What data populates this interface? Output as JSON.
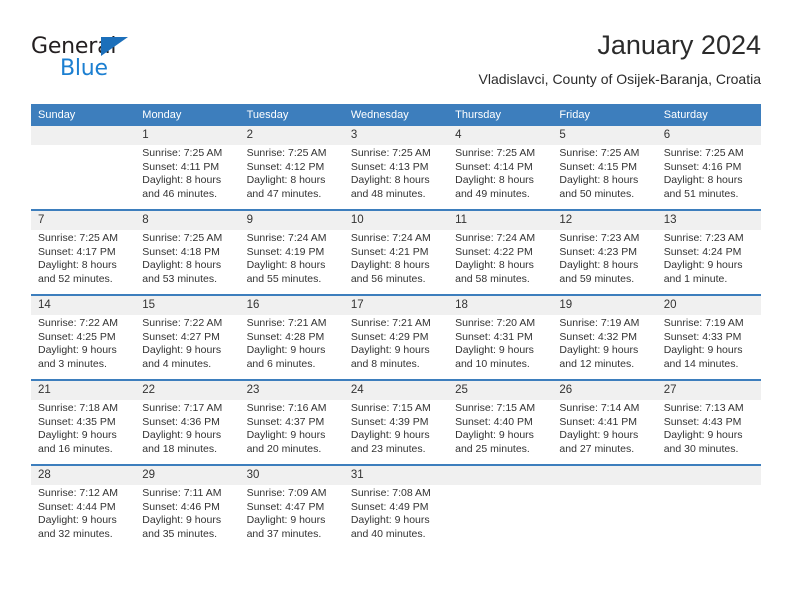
{
  "brand": {
    "name_top": "General",
    "name_bottom": "Blue",
    "triangle_color": "#1c6fba",
    "blue_color": "#1c7fd1"
  },
  "header": {
    "title": "January 2024",
    "subtitle": "Vladislavci, County of Osijek-Baranja, Croatia"
  },
  "theme": {
    "header_blue": "#3d7ebd",
    "daynum_band": "#f0f0f0",
    "cell_bg": "#ffffff",
    "text": "#333333"
  },
  "calendar": {
    "weekday_headers": [
      "Sunday",
      "Monday",
      "Tuesday",
      "Wednesday",
      "Thursday",
      "Friday",
      "Saturday"
    ],
    "weeks": [
      [
        {
          "day": "",
          "lines": []
        },
        {
          "day": "1",
          "lines": [
            "Sunrise: 7:25 AM",
            "Sunset: 4:11 PM",
            "Daylight: 8 hours",
            "and 46 minutes."
          ]
        },
        {
          "day": "2",
          "lines": [
            "Sunrise: 7:25 AM",
            "Sunset: 4:12 PM",
            "Daylight: 8 hours",
            "and 47 minutes."
          ]
        },
        {
          "day": "3",
          "lines": [
            "Sunrise: 7:25 AM",
            "Sunset: 4:13 PM",
            "Daylight: 8 hours",
            "and 48 minutes."
          ]
        },
        {
          "day": "4",
          "lines": [
            "Sunrise: 7:25 AM",
            "Sunset: 4:14 PM",
            "Daylight: 8 hours",
            "and 49 minutes."
          ]
        },
        {
          "day": "5",
          "lines": [
            "Sunrise: 7:25 AM",
            "Sunset: 4:15 PM",
            "Daylight: 8 hours",
            "and 50 minutes."
          ]
        },
        {
          "day": "6",
          "lines": [
            "Sunrise: 7:25 AM",
            "Sunset: 4:16 PM",
            "Daylight: 8 hours",
            "and 51 minutes."
          ]
        }
      ],
      [
        {
          "day": "7",
          "lines": [
            "Sunrise: 7:25 AM",
            "Sunset: 4:17 PM",
            "Daylight: 8 hours",
            "and 52 minutes."
          ]
        },
        {
          "day": "8",
          "lines": [
            "Sunrise: 7:25 AM",
            "Sunset: 4:18 PM",
            "Daylight: 8 hours",
            "and 53 minutes."
          ]
        },
        {
          "day": "9",
          "lines": [
            "Sunrise: 7:24 AM",
            "Sunset: 4:19 PM",
            "Daylight: 8 hours",
            "and 55 minutes."
          ]
        },
        {
          "day": "10",
          "lines": [
            "Sunrise: 7:24 AM",
            "Sunset: 4:21 PM",
            "Daylight: 8 hours",
            "and 56 minutes."
          ]
        },
        {
          "day": "11",
          "lines": [
            "Sunrise: 7:24 AM",
            "Sunset: 4:22 PM",
            "Daylight: 8 hours",
            "and 58 minutes."
          ]
        },
        {
          "day": "12",
          "lines": [
            "Sunrise: 7:23 AM",
            "Sunset: 4:23 PM",
            "Daylight: 8 hours",
            "and 59 minutes."
          ]
        },
        {
          "day": "13",
          "lines": [
            "Sunrise: 7:23 AM",
            "Sunset: 4:24 PM",
            "Daylight: 9 hours",
            "and 1 minute."
          ]
        }
      ],
      [
        {
          "day": "14",
          "lines": [
            "Sunrise: 7:22 AM",
            "Sunset: 4:25 PM",
            "Daylight: 9 hours",
            "and 3 minutes."
          ]
        },
        {
          "day": "15",
          "lines": [
            "Sunrise: 7:22 AM",
            "Sunset: 4:27 PM",
            "Daylight: 9 hours",
            "and 4 minutes."
          ]
        },
        {
          "day": "16",
          "lines": [
            "Sunrise: 7:21 AM",
            "Sunset: 4:28 PM",
            "Daylight: 9 hours",
            "and 6 minutes."
          ]
        },
        {
          "day": "17",
          "lines": [
            "Sunrise: 7:21 AM",
            "Sunset: 4:29 PM",
            "Daylight: 9 hours",
            "and 8 minutes."
          ]
        },
        {
          "day": "18",
          "lines": [
            "Sunrise: 7:20 AM",
            "Sunset: 4:31 PM",
            "Daylight: 9 hours",
            "and 10 minutes."
          ]
        },
        {
          "day": "19",
          "lines": [
            "Sunrise: 7:19 AM",
            "Sunset: 4:32 PM",
            "Daylight: 9 hours",
            "and 12 minutes."
          ]
        },
        {
          "day": "20",
          "lines": [
            "Sunrise: 7:19 AM",
            "Sunset: 4:33 PM",
            "Daylight: 9 hours",
            "and 14 minutes."
          ]
        }
      ],
      [
        {
          "day": "21",
          "lines": [
            "Sunrise: 7:18 AM",
            "Sunset: 4:35 PM",
            "Daylight: 9 hours",
            "and 16 minutes."
          ]
        },
        {
          "day": "22",
          "lines": [
            "Sunrise: 7:17 AM",
            "Sunset: 4:36 PM",
            "Daylight: 9 hours",
            "and 18 minutes."
          ]
        },
        {
          "day": "23",
          "lines": [
            "Sunrise: 7:16 AM",
            "Sunset: 4:37 PM",
            "Daylight: 9 hours",
            "and 20 minutes."
          ]
        },
        {
          "day": "24",
          "lines": [
            "Sunrise: 7:15 AM",
            "Sunset: 4:39 PM",
            "Daylight: 9 hours",
            "and 23 minutes."
          ]
        },
        {
          "day": "25",
          "lines": [
            "Sunrise: 7:15 AM",
            "Sunset: 4:40 PM",
            "Daylight: 9 hours",
            "and 25 minutes."
          ]
        },
        {
          "day": "26",
          "lines": [
            "Sunrise: 7:14 AM",
            "Sunset: 4:41 PM",
            "Daylight: 9 hours",
            "and 27 minutes."
          ]
        },
        {
          "day": "27",
          "lines": [
            "Sunrise: 7:13 AM",
            "Sunset: 4:43 PM",
            "Daylight: 9 hours",
            "and 30 minutes."
          ]
        }
      ],
      [
        {
          "day": "28",
          "lines": [
            "Sunrise: 7:12 AM",
            "Sunset: 4:44 PM",
            "Daylight: 9 hours",
            "and 32 minutes."
          ]
        },
        {
          "day": "29",
          "lines": [
            "Sunrise: 7:11 AM",
            "Sunset: 4:46 PM",
            "Daylight: 9 hours",
            "and 35 minutes."
          ]
        },
        {
          "day": "30",
          "lines": [
            "Sunrise: 7:09 AM",
            "Sunset: 4:47 PM",
            "Daylight: 9 hours",
            "and 37 minutes."
          ]
        },
        {
          "day": "31",
          "lines": [
            "Sunrise: 7:08 AM",
            "Sunset: 4:49 PM",
            "Daylight: 9 hours",
            "and 40 minutes."
          ]
        },
        {
          "day": "",
          "lines": []
        },
        {
          "day": "",
          "lines": []
        },
        {
          "day": "",
          "lines": []
        }
      ]
    ]
  }
}
